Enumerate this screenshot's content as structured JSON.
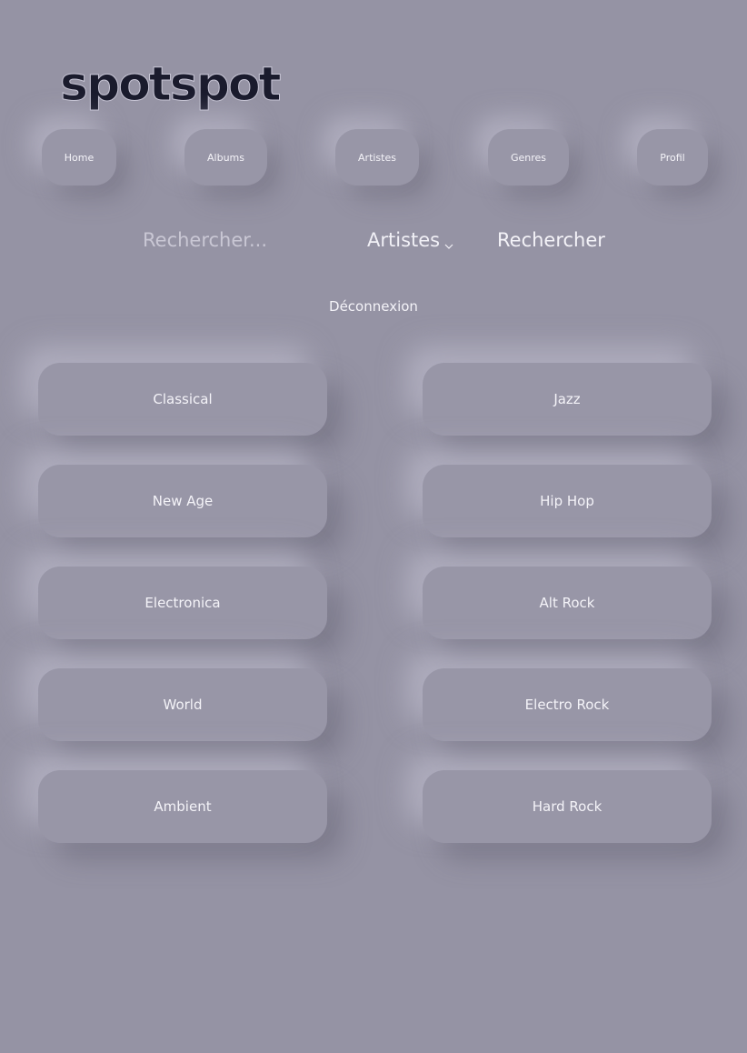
{
  "brand": {
    "logo_text": "Spotspot"
  },
  "nav": {
    "home": "Home",
    "albums": "Albums",
    "artists": "Artistes",
    "genres": "Genres",
    "profile": "Profil"
  },
  "search": {
    "placeholder": "Rechercher...",
    "value": "",
    "filter_selected": "Artistes",
    "submit_label": "Rechercher"
  },
  "logout_label": "Déconnexion",
  "genres": [
    "Classical",
    "Jazz",
    "New Age",
    "Hip Hop",
    "Electronica",
    "Alt Rock",
    "World",
    "Electro Rock",
    "Ambient",
    "Hard Rock"
  ],
  "colors": {
    "background": "#9593a4",
    "card": "#9896a7",
    "text": "#f4f3f8",
    "logo_fill": "#191a2c"
  },
  "icons": {
    "filter_dropdown": "chevron-down-icon"
  }
}
